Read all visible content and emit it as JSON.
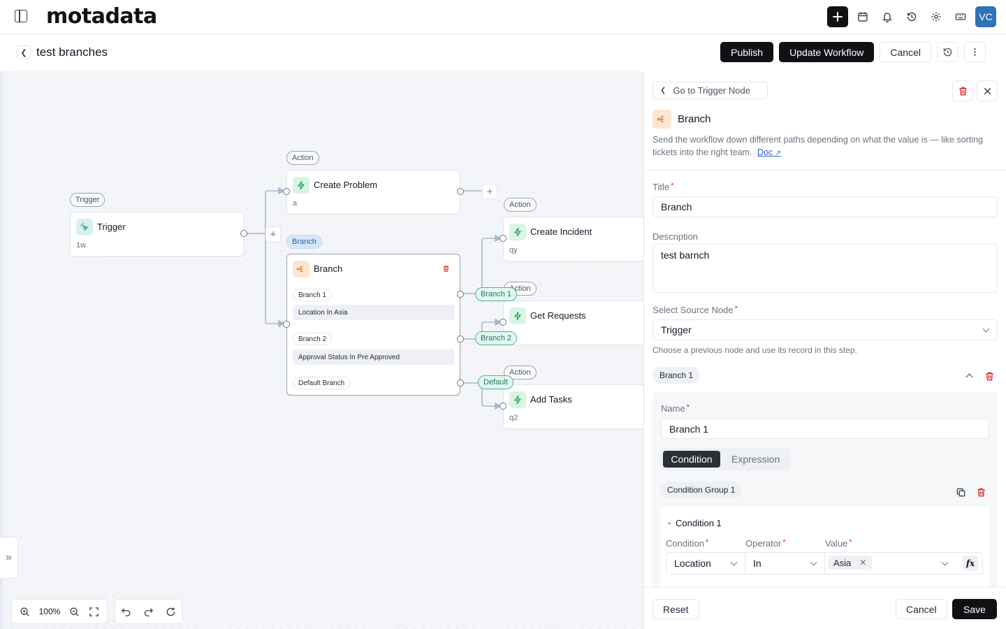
{
  "app": {
    "logo": "motadata"
  },
  "user": {
    "initials": "VC"
  },
  "header": {
    "title": "test branches",
    "publish": "Publish",
    "update": "Update Workflow",
    "cancel": "Cancel"
  },
  "canvas": {
    "labels": {
      "action": "Action",
      "trigger": "Trigger",
      "branch": "Branch"
    },
    "trigger_node": {
      "title": "Trigger",
      "sub": "1w"
    },
    "create_problem": {
      "title": "Create Problem",
      "sub": "a"
    },
    "branch_node": {
      "title": "Branch",
      "branches": [
        {
          "name": "Branch 1",
          "condition": "Location In Asia"
        },
        {
          "name": "Branch 2",
          "condition": "Approval Status In Pre Approved"
        }
      ],
      "default": "Default Branch"
    },
    "edge_labels": [
      "Branch 1",
      "Branch 2",
      "Default"
    ],
    "create_incident": {
      "title": "Create Incident",
      "sub": "qy"
    },
    "get_requests": {
      "title": "Get Requests",
      "sub": "q"
    },
    "add_tasks": {
      "title": "Add Tasks",
      "sub": "q2"
    },
    "zoom": "100%"
  },
  "panel": {
    "goto": "Go to Trigger Node",
    "name": "Branch",
    "description": "Send the workflow down different paths depending on what the value is — like sorting tickets into the right team.",
    "doc_link": "Doc",
    "title_label": "Title",
    "title_value": "Branch",
    "description_label": "Description",
    "description_value": "test barnch",
    "source_label": "Select Source Node",
    "source_value": "Trigger",
    "source_hint": "Choose a previous node and use its record in this step.",
    "branch_chip": "Branch 1",
    "branch_name_label": "Name",
    "branch_name_value": "Branch 1",
    "mode_condition": "Condition",
    "mode_expression": "Expression",
    "group_label": "Condition Group 1",
    "condition_title": "Condition 1",
    "col_condition": "Condition",
    "col_operator": "Operator",
    "col_value": "Value",
    "cond_field": "Location",
    "cond_operator": "In",
    "cond_value_tag": "Asia",
    "fx": "fx",
    "reset": "Reset",
    "cancel": "Cancel",
    "save": "Save"
  }
}
